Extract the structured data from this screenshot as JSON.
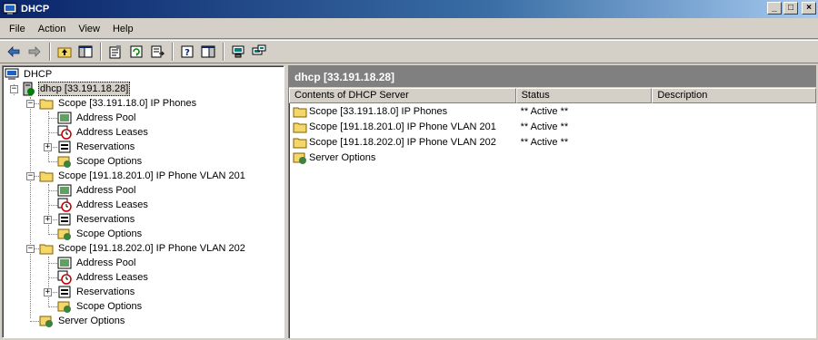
{
  "window": {
    "title": "DHCP",
    "icon": "dhcp-console-icon",
    "buttons": {
      "minimize": "_",
      "maximize": "□",
      "close": "×"
    }
  },
  "menu": [
    "File",
    "Action",
    "View",
    "Help"
  ],
  "toolbar": {
    "icons": [
      "back-arrow-icon",
      "forward-arrow-icon",
      "up-folder-icon",
      "show-hide-tree-icon",
      "properties-icon",
      "refresh-icon",
      "export-list-icon",
      "help-icon",
      "show-hide-action-pane-icon",
      "server-icon",
      "add-server-icon"
    ]
  },
  "tree": {
    "root": "DHCP",
    "server": "dhcp [33.191.18.28]",
    "scopes": [
      {
        "label": "Scope [33.191.18.0] IP Phones",
        "children": [
          "Address Pool",
          "Address Leases",
          "Reservations",
          "Scope Options"
        ]
      },
      {
        "label": "Scope [191.18.201.0] IP Phone VLAN 201",
        "children": [
          "Address Pool",
          "Address Leases",
          "Reservations",
          "Scope Options"
        ]
      },
      {
        "label": "Scope [191.18.202.0] IP Phone VLAN 202",
        "children": [
          "Address Pool",
          "Address Leases",
          "Reservations",
          "Scope Options"
        ]
      }
    ],
    "server_options": "Server Options"
  },
  "right": {
    "header": "dhcp [33.191.18.28]",
    "columns": [
      "Contents of DHCP Server",
      "Status",
      "Description"
    ],
    "rows": [
      {
        "name": "Scope [33.191.18.0] IP Phones",
        "status": "** Active **",
        "description": "",
        "icon": "folder-icon"
      },
      {
        "name": "Scope [191.18.201.0] IP Phone VLAN 201",
        "status": "** Active **",
        "description": "",
        "icon": "folder-icon"
      },
      {
        "name": "Scope [191.18.202.0] IP Phone VLAN 202",
        "status": "** Active **",
        "description": "",
        "icon": "folder-icon"
      },
      {
        "name": "Server Options",
        "status": "",
        "description": "",
        "icon": "server-options-icon"
      }
    ]
  },
  "colors": {
    "title_dark": "#0a246a",
    "title_light": "#a6caf0",
    "chrome": "#d4d0c8",
    "pane_header": "#808080",
    "folder": "#f5d66b"
  }
}
